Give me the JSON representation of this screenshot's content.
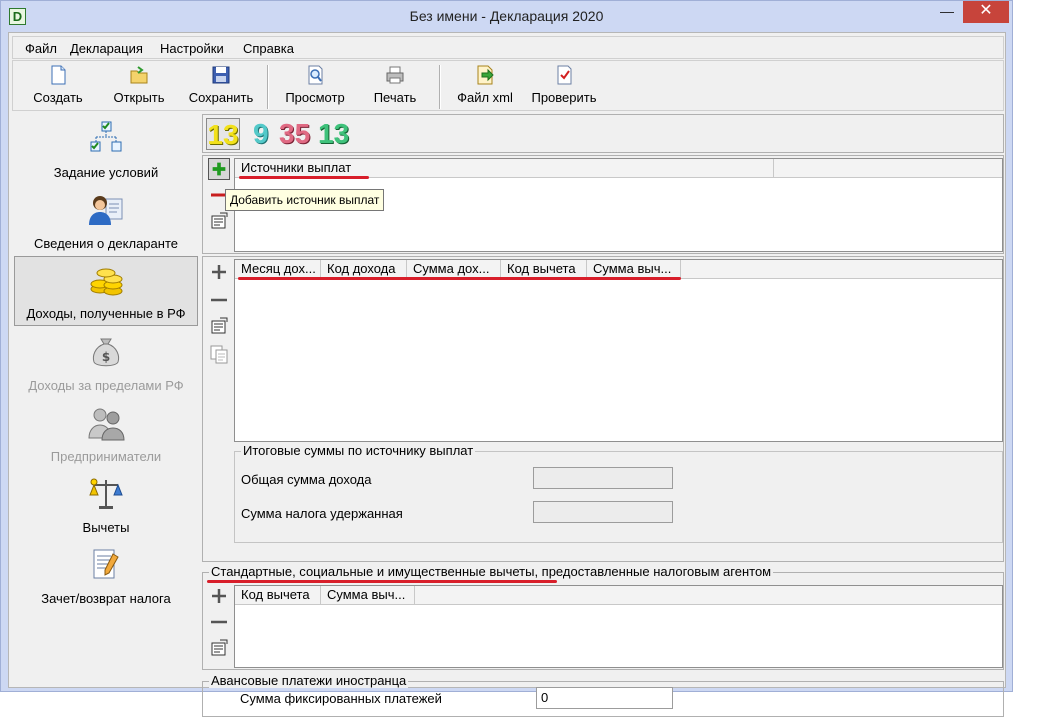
{
  "window": {
    "title": "Без имени - Декларация 2020",
    "app_icon": "D",
    "minimize_glyph": "—",
    "close_glyph": "✕"
  },
  "menu": [
    "Файл",
    "Декларация",
    "Настройки",
    "Справка"
  ],
  "toolbar": {
    "create": "Создать",
    "open": "Открыть",
    "save": "Сохранить",
    "preview": "Просмотр",
    "print": "Печать",
    "xml": "Файл xml",
    "check": "Проверить"
  },
  "nav": {
    "conditions": "Задание условий",
    "declarant": "Сведения о декларанте",
    "income_rf": "Доходы, полученные в РФ",
    "income_abroad": "Доходы за пределами РФ",
    "entrepreneurs": "Предприниматели",
    "deductions": "Вычеты",
    "tax_refund": "Зачет/возврат налога"
  },
  "rate_tabs": [
    "13",
    "9",
    "35",
    "13"
  ],
  "sources": {
    "header": "Источники выплат",
    "tooltip": "Добавить источник выплат"
  },
  "income_grid": {
    "columns": [
      "Месяц дох...",
      "Код дохода",
      "Сумма дох...",
      "Код вычета",
      "Сумма выч..."
    ]
  },
  "totals": {
    "title": "Итоговые суммы по источнику выплат",
    "total_income_label": "Общая сумма дохода",
    "tax_withheld_label": "Сумма налога удержанная"
  },
  "deductions_agent": {
    "title": "Стандартные, социальные и имущественные вычеты, предоставленные налоговым агентом",
    "columns": [
      "Код вычета",
      "Сумма выч..."
    ]
  },
  "advance": {
    "title": "Авансовые платежи иностранца",
    "fixed_payments_label": "Сумма фиксированных платежей",
    "fixed_payments_value": "0"
  },
  "colors": {
    "title_bar": "#cdd8f3",
    "close_button": "#c7443b",
    "annotation_red": "#d81e2a"
  }
}
